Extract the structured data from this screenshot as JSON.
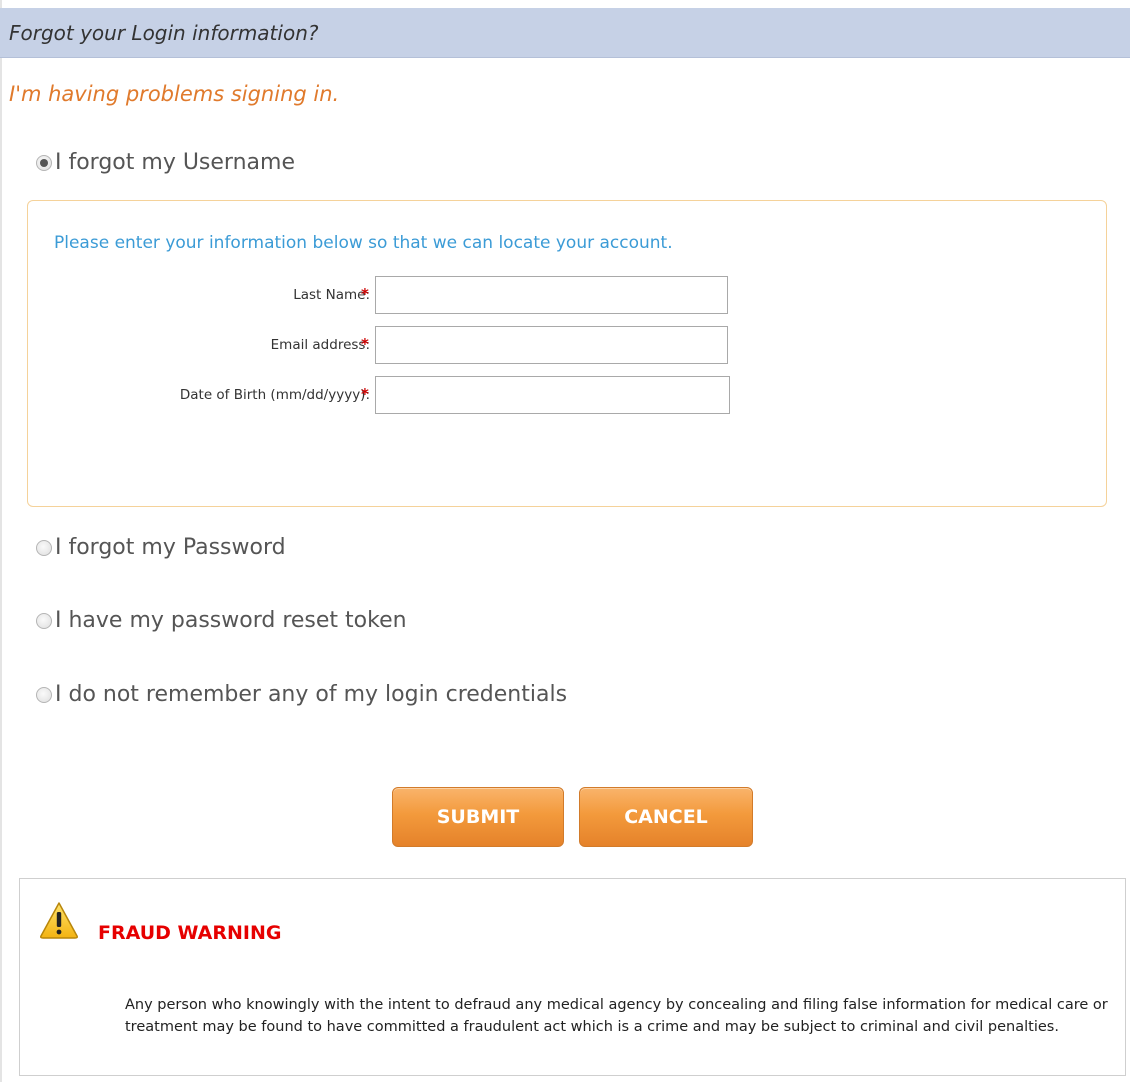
{
  "header": {
    "title": "Forgot your Login information?"
  },
  "subtitle": "I'm having problems signing in.",
  "options": [
    {
      "label": "I forgot my Username",
      "checked": true
    },
    {
      "label": "I forgot my Password",
      "checked": false
    },
    {
      "label": "I have my password reset token",
      "checked": false
    },
    {
      "label": "I do not remember any of my login credentials",
      "checked": false
    }
  ],
  "username_panel": {
    "intro": "Please enter your information below so that we can locate your account.",
    "fields": [
      {
        "label": "Last Name:",
        "required_mark": "*",
        "value": ""
      },
      {
        "label": "Email address:",
        "required_mark": "*",
        "value": ""
      },
      {
        "label": "Date of Birth (mm/dd/yyyy):",
        "required_mark": "*",
        "value": ""
      }
    ]
  },
  "buttons": {
    "submit": "SUBMIT",
    "cancel": "CANCEL"
  },
  "fraud_warning": {
    "icon": "warning-icon",
    "title": "FRAUD WARNING",
    "text": "Any person who knowingly with the intent to defraud any medical agency by concealing and filing false information for medical care or treatment may be found to have committed a fraudulent act which is a crime and may be subject to criminal and civil penalties."
  },
  "colors": {
    "header_bg": "#c6d1e6",
    "subtitle": "#e07a2c",
    "intro": "#3b9bd6",
    "button": "#f39a3c",
    "warning_title": "#e60000",
    "panel_border": "#f5d29a"
  }
}
